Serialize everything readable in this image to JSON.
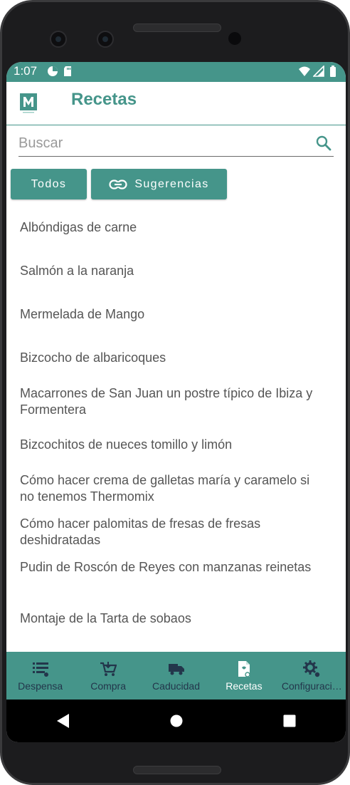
{
  "status_bar": {
    "time": "1:07"
  },
  "app_bar": {
    "title": "Recetas",
    "logo_letter": "M"
  },
  "search": {
    "placeholder": "Buscar",
    "value": ""
  },
  "filters": {
    "all_label": "Todos",
    "suggestions_label": "Sugerencias"
  },
  "recipes": [
    "Albóndigas de carne",
    "Salmón a la naranja",
    "Mermelada de Mango",
    "Bizcocho de albaricoques",
    "Macarrones de San Juan un postre típico de Ibiza y Formentera",
    "Bizcochitos de nueces tomillo y limón",
    "Cómo hacer crema de galletas maría y caramelo si no tenemos Thermomix",
    "Cómo hacer palomitas de fresas de fresas deshidratadas",
    "Pudin de Roscón de Reyes con manzanas reinetas",
    "Montaje de la Tarta de sobaos"
  ],
  "bottom_nav": [
    {
      "label": "Despensa",
      "icon": "pantry-list-icon",
      "active": false
    },
    {
      "label": "Compra",
      "icon": "shopping-cart-icon",
      "active": false
    },
    {
      "label": "Caducidad",
      "icon": "expiry-truck-icon",
      "active": false
    },
    {
      "label": "Recetas",
      "icon": "recipe-book-icon",
      "active": true
    },
    {
      "label": "Configuraci…",
      "icon": "settings-gear-icon",
      "active": false
    }
  ],
  "colors": {
    "primary": "#45958a",
    "inactive_nav": "#23364b",
    "text": "#555555"
  }
}
